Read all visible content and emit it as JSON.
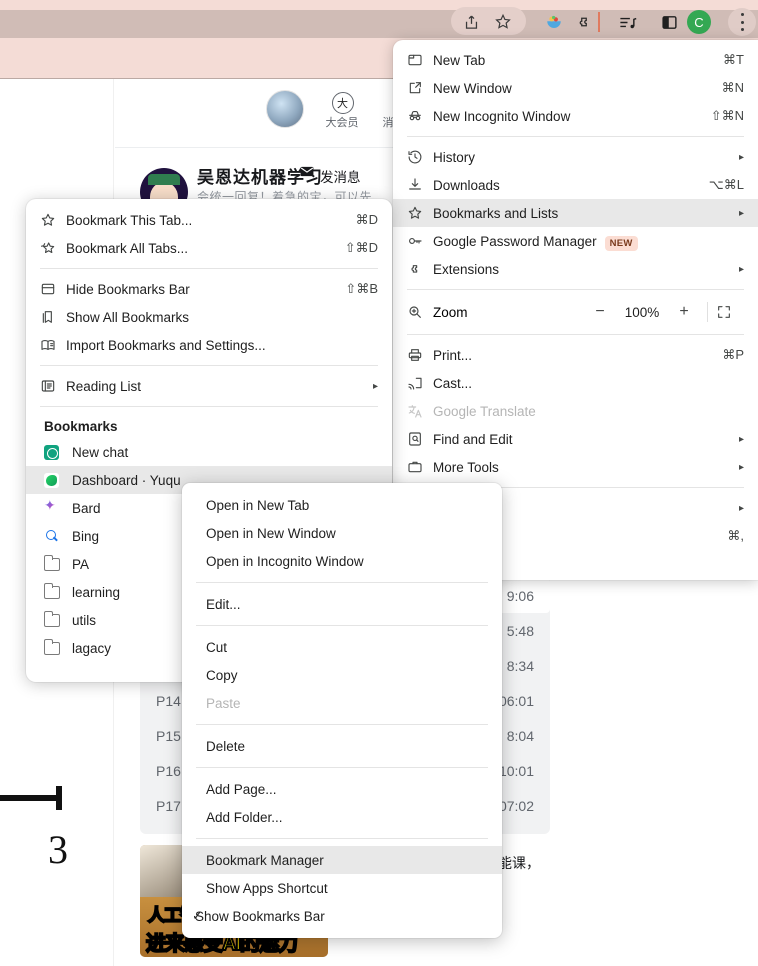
{
  "toolbar": {
    "icons": [
      {
        "name": "share-icon",
        "glyph": "share"
      },
      {
        "name": "bookmark-star-icon",
        "glyph": "star"
      },
      {
        "name": "salad-extension-icon",
        "glyph": "bowl"
      },
      {
        "name": "extensions-puzzle-icon",
        "glyph": "puzzle"
      },
      {
        "name": "media-playlist-icon",
        "glyph": "playlist"
      },
      {
        "name": "side-panel-icon",
        "glyph": "panel"
      }
    ],
    "avatar_initial": "C",
    "avatar_color": "#34a853",
    "divider_color": "#e07a5f"
  },
  "page": {
    "member_label": "大会员",
    "message_label_partial": "消",
    "up_name": "吴恩达机器学习",
    "up_message": "发消息",
    "up_desc": "会统一回复！着急的宝，可以先",
    "episodes": {
      "rows": [
        {
          "label": "",
          "time": "9:06",
          "active": true
        },
        {
          "label": "",
          "time": "5:48",
          "active": false
        },
        {
          "label": "",
          "time": "8:34",
          "active": false
        },
        {
          "label": "P14",
          "time": "06:01",
          "active": false
        },
        {
          "label": "P15",
          "time": "8:04",
          "active": false
        },
        {
          "label": "P16",
          "time": "10:01",
          "active": false
        },
        {
          "label": "P17",
          "time": "07:02",
          "active": false
        }
      ]
    },
    "video_card": {
      "thumb_text_line1": "人工智",
      "thumb_text_line2": "进来感受AI的魅力",
      "title_fragment": "能课，"
    },
    "stray_number": "3"
  },
  "chrome_menu": {
    "items": [
      {
        "id": "new-tab",
        "label": "New Tab",
        "accel": "⌘T",
        "icon": "new-tab-icon",
        "arrow": false,
        "selected": false,
        "disabled": false
      },
      {
        "id": "new-window",
        "label": "New Window",
        "accel": "⌘N",
        "icon": "new-window-icon",
        "arrow": false,
        "selected": false,
        "disabled": false
      },
      {
        "id": "new-incognito-window",
        "label": "New Incognito Window",
        "accel": "⇧⌘N",
        "icon": "incognito-icon",
        "arrow": false,
        "selected": false,
        "disabled": false
      },
      {
        "id": "sep1",
        "separator": true
      },
      {
        "id": "history",
        "label": "History",
        "accel": "",
        "icon": "history-icon",
        "arrow": true,
        "selected": false,
        "disabled": false
      },
      {
        "id": "downloads",
        "label": "Downloads",
        "accel": "⌥⌘L",
        "icon": "downloads-icon",
        "arrow": false,
        "selected": false,
        "disabled": false
      },
      {
        "id": "bookmarks-and-lists",
        "label": "Bookmarks and Lists",
        "accel": "",
        "icon": "star-icon",
        "arrow": true,
        "selected": true,
        "disabled": false
      },
      {
        "id": "google-password-manager",
        "label": "Google Password Manager",
        "accel": "",
        "icon": "key-icon",
        "arrow": false,
        "selected": false,
        "disabled": false,
        "badge": "NEW"
      },
      {
        "id": "extensions",
        "label": "Extensions",
        "accel": "",
        "icon": "puzzle-icon",
        "arrow": true,
        "selected": false,
        "disabled": false
      },
      {
        "id": "sep2",
        "separator": true
      }
    ],
    "zoom": {
      "label": "Zoom",
      "icon": "zoom-magnifier-icon",
      "minus": "−",
      "value": "100%",
      "plus": "+",
      "fullscreen": "fullscreen-icon"
    },
    "items2": [
      {
        "id": "sep3",
        "separator": true
      },
      {
        "id": "print",
        "label": "Print...",
        "accel": "⌘P",
        "icon": "printer-icon",
        "arrow": false,
        "selected": false,
        "disabled": false
      },
      {
        "id": "cast",
        "label": "Cast...",
        "accel": "",
        "icon": "cast-icon",
        "arrow": false,
        "selected": false,
        "disabled": false
      },
      {
        "id": "google-translate",
        "label": "Google Translate",
        "accel": "",
        "icon": "translate-icon",
        "arrow": false,
        "selected": false,
        "disabled": true
      },
      {
        "id": "find-and-edit",
        "label": "Find and Edit",
        "accel": "",
        "icon": "find-icon",
        "arrow": true,
        "selected": false,
        "disabled": false
      },
      {
        "id": "more-tools",
        "label": "More Tools",
        "accel": "",
        "icon": "more-tools-icon",
        "arrow": true,
        "selected": false,
        "disabled": false
      },
      {
        "id": "sep4",
        "separator": true
      },
      {
        "id": "help",
        "label": "",
        "accel": "",
        "icon": "",
        "arrow": true,
        "selected": false,
        "disabled": false
      },
      {
        "id": "settings",
        "label": "",
        "accel": "⌘,",
        "icon": "",
        "arrow": false,
        "selected": false,
        "disabled": false
      }
    ]
  },
  "bookmarks_menu": {
    "items": [
      {
        "id": "bookmark-this-tab",
        "label": "Bookmark This Tab...",
        "accel": "⌘D",
        "icon": "star-outline-icon",
        "arrow": false,
        "selected": false
      },
      {
        "id": "bookmark-all-tabs",
        "label": "Bookmark All Tabs...",
        "accel": "⇧⌘D",
        "icon": "star-multi-icon",
        "arrow": false,
        "selected": false
      },
      {
        "id": "sep1",
        "separator": true
      },
      {
        "id": "hide-bookmarks-bar",
        "label": "Hide Bookmarks Bar",
        "accel": "⇧⌘B",
        "icon": "bookmarks-bar-icon",
        "arrow": false,
        "selected": false
      },
      {
        "id": "show-all-bookmarks",
        "label": "Show All Bookmarks",
        "accel": "",
        "icon": "all-bookmarks-icon",
        "arrow": false,
        "selected": false
      },
      {
        "id": "import-bookmarks-and-settings",
        "label": "Import Bookmarks and Settings...",
        "accel": "",
        "icon": "import-icon",
        "arrow": false,
        "selected": false
      },
      {
        "id": "sep2",
        "separator": true
      },
      {
        "id": "reading-list",
        "label": "Reading List",
        "accel": "",
        "icon": "reading-list-icon",
        "arrow": true,
        "selected": false
      },
      {
        "id": "sep3",
        "separator": true
      }
    ],
    "section_header": "Bookmarks",
    "bookmarks": [
      {
        "id": "new-chat",
        "label": "New chat",
        "favicon": "chatgpt-favicon",
        "selected": false
      },
      {
        "id": "dashboard-yuque",
        "label": "Dashboard · Yuqu",
        "favicon": "yuque-favicon",
        "selected": true
      },
      {
        "id": "bard",
        "label": "Bard",
        "favicon": "bard-favicon",
        "selected": false
      },
      {
        "id": "bing",
        "label": "Bing",
        "favicon": "bing-favicon",
        "selected": false
      },
      {
        "id": "pa",
        "label": "PA",
        "favicon": "folder-favicon",
        "selected": false
      },
      {
        "id": "learning",
        "label": "learning",
        "favicon": "folder-favicon",
        "selected": false
      },
      {
        "id": "utils",
        "label": "utils",
        "favicon": "folder-favicon",
        "selected": false
      },
      {
        "id": "lagacy",
        "label": "lagacy",
        "favicon": "folder-favicon",
        "selected": false
      }
    ]
  },
  "context_menu": {
    "items": [
      {
        "id": "open-in-new-tab",
        "label": "Open in New Tab",
        "selected": false,
        "disabled": false,
        "check": false
      },
      {
        "id": "open-in-new-window",
        "label": "Open in New Window",
        "selected": false,
        "disabled": false,
        "check": false
      },
      {
        "id": "open-in-incognito-window",
        "label": "Open in Incognito Window",
        "selected": false,
        "disabled": false,
        "check": false
      },
      {
        "id": "sep1",
        "separator": true
      },
      {
        "id": "edit",
        "label": "Edit...",
        "selected": false,
        "disabled": false,
        "check": false
      },
      {
        "id": "sep2",
        "separator": true
      },
      {
        "id": "cut",
        "label": "Cut",
        "selected": false,
        "disabled": false,
        "check": false
      },
      {
        "id": "copy",
        "label": "Copy",
        "selected": false,
        "disabled": false,
        "check": false
      },
      {
        "id": "paste",
        "label": "Paste",
        "selected": false,
        "disabled": true,
        "check": false
      },
      {
        "id": "sep3",
        "separator": true
      },
      {
        "id": "delete",
        "label": "Delete",
        "selected": false,
        "disabled": false,
        "check": false
      },
      {
        "id": "sep4",
        "separator": true
      },
      {
        "id": "add-page",
        "label": "Add Page...",
        "selected": false,
        "disabled": false,
        "check": false
      },
      {
        "id": "add-folder",
        "label": "Add Folder...",
        "selected": false,
        "disabled": false,
        "check": false
      },
      {
        "id": "sep5",
        "separator": true
      },
      {
        "id": "bookmark-manager",
        "label": "Bookmark Manager",
        "selected": true,
        "disabled": false,
        "check": false
      },
      {
        "id": "show-apps-shortcut",
        "label": "Show Apps Shortcut",
        "selected": false,
        "disabled": false,
        "check": false
      },
      {
        "id": "show-bookmarks-bar",
        "label": "Show Bookmarks Bar",
        "selected": false,
        "disabled": false,
        "check": true
      }
    ]
  }
}
